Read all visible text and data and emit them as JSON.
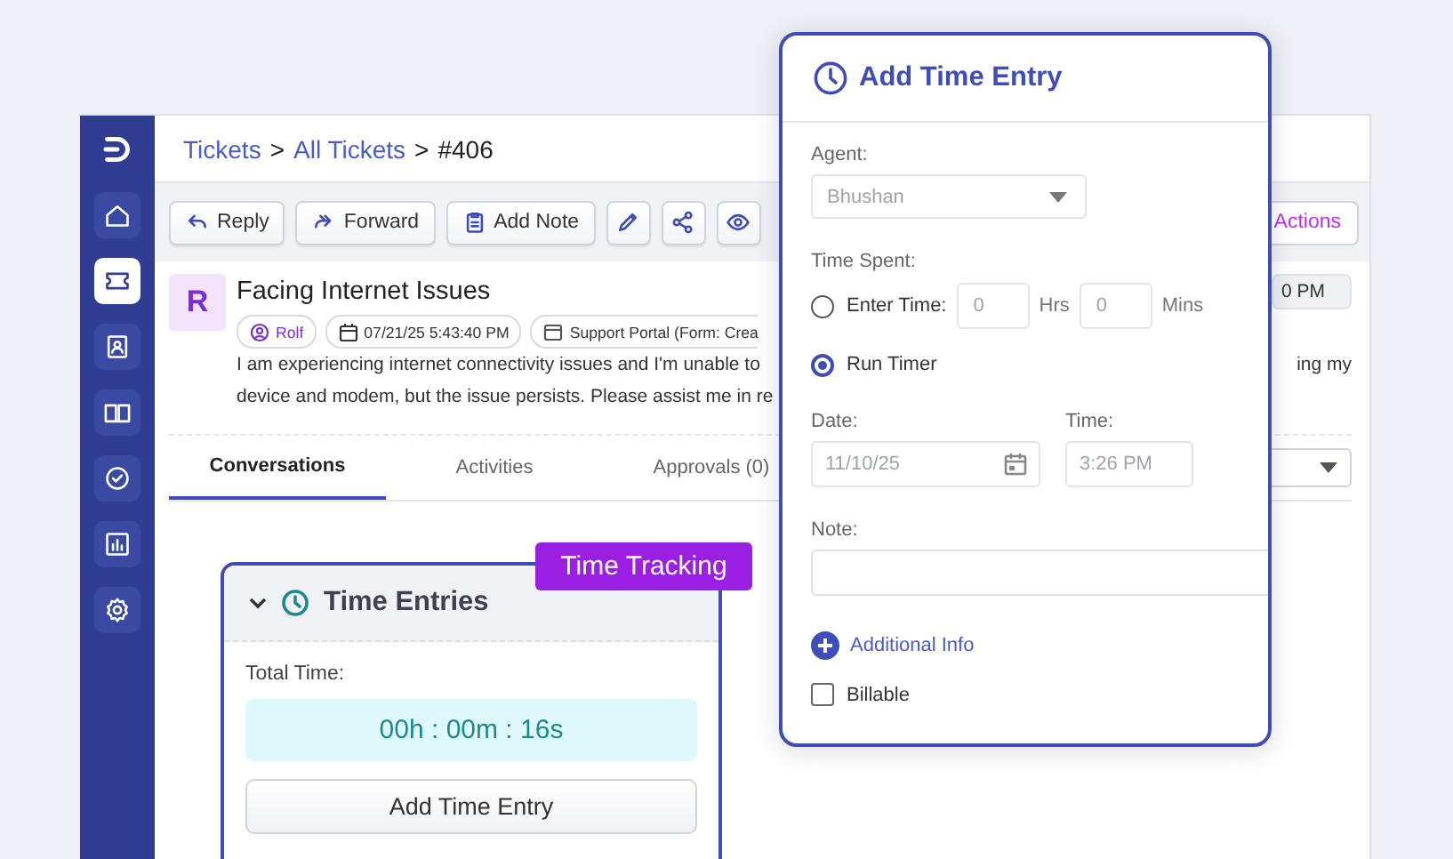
{
  "sidebar": {
    "items": [
      {
        "kind": "logo",
        "selected": false
      },
      {
        "kind": "home",
        "selected": false
      },
      {
        "kind": "ticket",
        "selected": true
      },
      {
        "kind": "contact",
        "selected": false
      },
      {
        "kind": "book",
        "selected": false
      },
      {
        "kind": "check",
        "selected": false
      },
      {
        "kind": "chart",
        "selected": false
      },
      {
        "kind": "gear",
        "selected": false
      }
    ]
  },
  "breadcrumb": [
    {
      "kind": "link",
      "label": "Tickets"
    },
    {
      "kind": "separator",
      "label": ">"
    },
    {
      "kind": "link",
      "label": "All Tickets"
    },
    {
      "kind": "separator",
      "label": ">"
    },
    {
      "kind": "current",
      "label": "#406"
    }
  ],
  "toolbar": {
    "buttons": [
      {
        "kind": "reply",
        "label": "Reply"
      },
      {
        "kind": "forward",
        "label": "Forward"
      },
      {
        "kind": "note",
        "label": "Add Note"
      },
      {
        "kind": "edit"
      },
      {
        "kind": "share"
      },
      {
        "kind": "view"
      }
    ],
    "actions_button": "Actions"
  },
  "ticket": {
    "avatar": "R",
    "title": "Facing Internet Issues",
    "side_chip": "0 PM",
    "meta": [
      {
        "kind": "user",
        "text": "Rolf"
      },
      {
        "kind": "date",
        "text": "07/21/25 5:43:40 PM"
      },
      {
        "kind": "source",
        "text": "Support Portal (Form: Crea"
      }
    ],
    "description": [
      {
        "left": "I am experiencing internet connectivity issues and I'm unable to",
        "right": "ing my"
      },
      {
        "left": "device and modem, but the issue persists. Please assist me in re"
      }
    ]
  },
  "tabs": [
    {
      "label": "Conversations",
      "selected": true
    },
    {
      "label": "Activities",
      "selected": false
    },
    {
      "label": "Approvals (0)",
      "selected": false
    }
  ],
  "time_entries": {
    "badge": "Time Tracking",
    "title": "Time Entries",
    "expanded": true,
    "total_label": "Total Time:",
    "total": "00h : 00m : 16s",
    "add_button": "Add Time Entry"
  },
  "dialog": {
    "title": "Add Time Entry",
    "agent_label": "Agent:",
    "agent_value": "Bhushan",
    "time_spent_label": "Time Spent:",
    "options": [
      {
        "kind": "manual",
        "label": "Enter Time:",
        "selected": false
      },
      {
        "kind": "timer",
        "label": "Run Timer",
        "selected": true
      }
    ],
    "hours": {
      "value": "0",
      "unit": "Hrs"
    },
    "minutes": {
      "value": "0",
      "unit": "Mins"
    },
    "date_label": "Date:",
    "date_value": "11/10/25",
    "time_label": "Time:",
    "time_value": "3:26 PM",
    "note_label": "Note:",
    "additional_info": "Additional Info",
    "billable": {
      "label": "Billable",
      "checked": false
    }
  }
}
